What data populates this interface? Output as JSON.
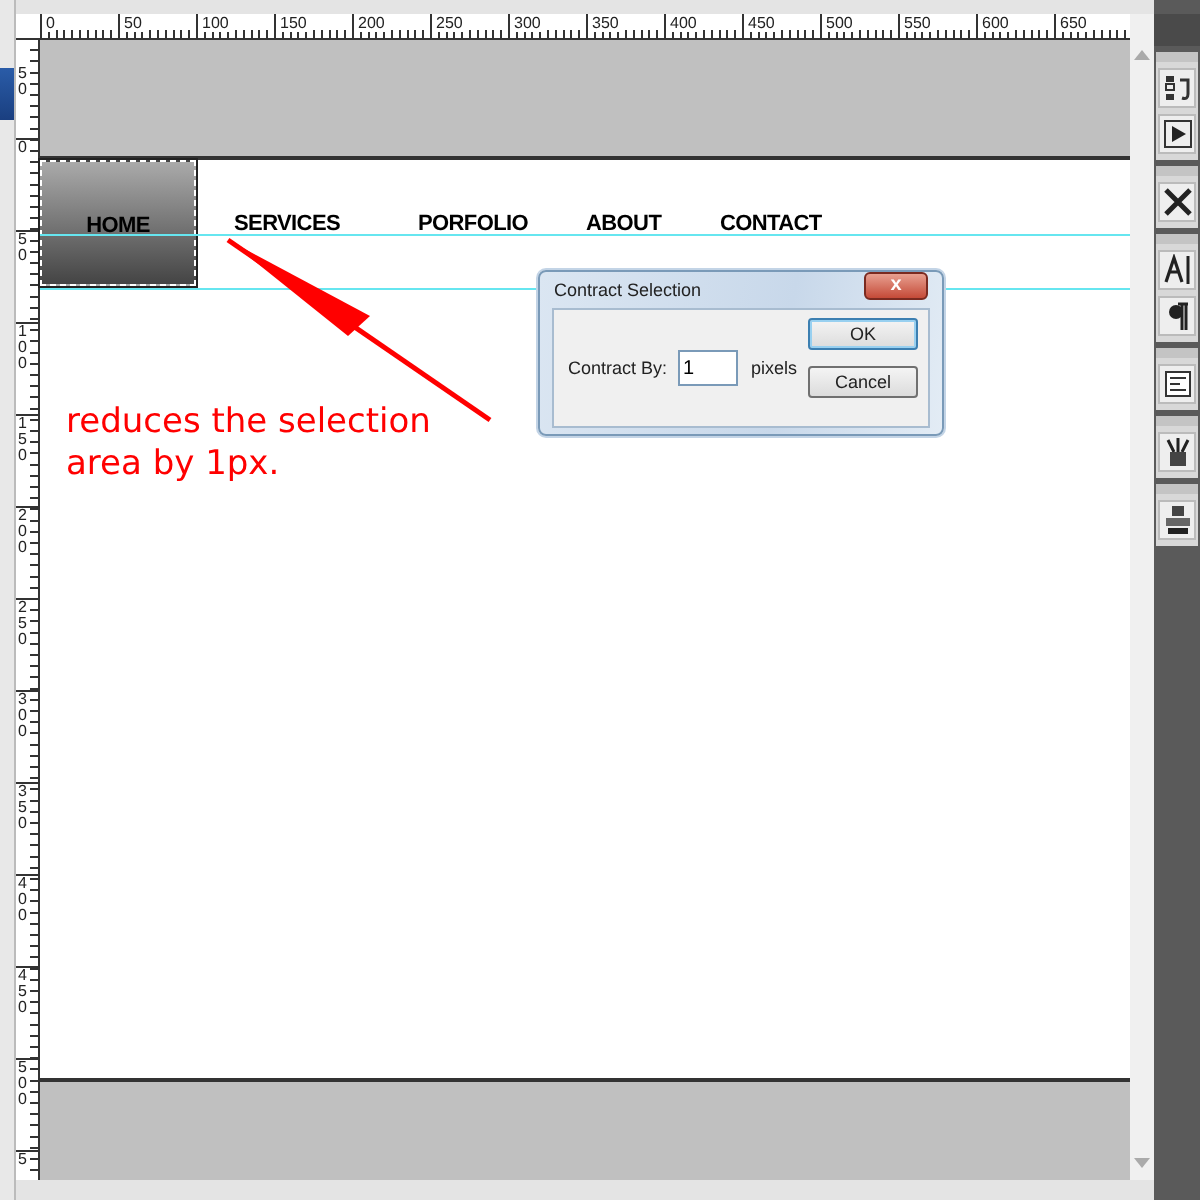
{
  "rulers": {
    "horizontal": [
      "0",
      "50",
      "100",
      "150",
      "200",
      "250",
      "300",
      "350",
      "400",
      "450",
      "500",
      "550",
      "600",
      "650"
    ],
    "vertical": [
      "50",
      "0",
      "50",
      "100",
      "150",
      "200",
      "250",
      "300",
      "350",
      "400",
      "450",
      "500",
      "5"
    ]
  },
  "canvas": {
    "nav": [
      {
        "label": "HOME",
        "selected": true
      },
      {
        "label": "SERVICES",
        "selected": false
      },
      {
        "label": "PORFOLIO",
        "selected": false
      },
      {
        "label": "ABOUT",
        "selected": false
      },
      {
        "label": "CONTACT",
        "selected": false
      }
    ],
    "annotation": "reduces the selection area by 1px."
  },
  "dialog": {
    "title": "Contract Selection",
    "close": "x",
    "field_label": "Contract By:",
    "value": "1",
    "unit": "pixels",
    "buttons": [
      "OK",
      "Cancel"
    ]
  }
}
